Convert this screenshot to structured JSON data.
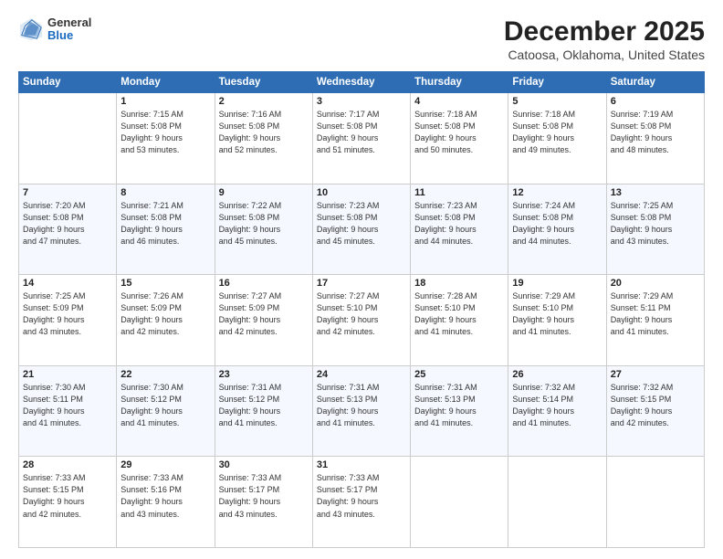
{
  "header": {
    "logo": {
      "general": "General",
      "blue": "Blue"
    },
    "title": "December 2025",
    "subtitle": "Catoosa, Oklahoma, United States"
  },
  "calendar": {
    "days_of_week": [
      "Sunday",
      "Monday",
      "Tuesday",
      "Wednesday",
      "Thursday",
      "Friday",
      "Saturday"
    ],
    "weeks": [
      [
        {
          "date": "",
          "info": ""
        },
        {
          "date": "1",
          "info": "Sunrise: 7:15 AM\nSunset: 5:08 PM\nDaylight: 9 hours\nand 53 minutes."
        },
        {
          "date": "2",
          "info": "Sunrise: 7:16 AM\nSunset: 5:08 PM\nDaylight: 9 hours\nand 52 minutes."
        },
        {
          "date": "3",
          "info": "Sunrise: 7:17 AM\nSunset: 5:08 PM\nDaylight: 9 hours\nand 51 minutes."
        },
        {
          "date": "4",
          "info": "Sunrise: 7:18 AM\nSunset: 5:08 PM\nDaylight: 9 hours\nand 50 minutes."
        },
        {
          "date": "5",
          "info": "Sunrise: 7:18 AM\nSunset: 5:08 PM\nDaylight: 9 hours\nand 49 minutes."
        },
        {
          "date": "6",
          "info": "Sunrise: 7:19 AM\nSunset: 5:08 PM\nDaylight: 9 hours\nand 48 minutes."
        }
      ],
      [
        {
          "date": "7",
          "info": "Sunrise: 7:20 AM\nSunset: 5:08 PM\nDaylight: 9 hours\nand 47 minutes."
        },
        {
          "date": "8",
          "info": "Sunrise: 7:21 AM\nSunset: 5:08 PM\nDaylight: 9 hours\nand 46 minutes."
        },
        {
          "date": "9",
          "info": "Sunrise: 7:22 AM\nSunset: 5:08 PM\nDaylight: 9 hours\nand 45 minutes."
        },
        {
          "date": "10",
          "info": "Sunrise: 7:23 AM\nSunset: 5:08 PM\nDaylight: 9 hours\nand 45 minutes."
        },
        {
          "date": "11",
          "info": "Sunrise: 7:23 AM\nSunset: 5:08 PM\nDaylight: 9 hours\nand 44 minutes."
        },
        {
          "date": "12",
          "info": "Sunrise: 7:24 AM\nSunset: 5:08 PM\nDaylight: 9 hours\nand 44 minutes."
        },
        {
          "date": "13",
          "info": "Sunrise: 7:25 AM\nSunset: 5:08 PM\nDaylight: 9 hours\nand 43 minutes."
        }
      ],
      [
        {
          "date": "14",
          "info": "Sunrise: 7:25 AM\nSunset: 5:09 PM\nDaylight: 9 hours\nand 43 minutes."
        },
        {
          "date": "15",
          "info": "Sunrise: 7:26 AM\nSunset: 5:09 PM\nDaylight: 9 hours\nand 42 minutes."
        },
        {
          "date": "16",
          "info": "Sunrise: 7:27 AM\nSunset: 5:09 PM\nDaylight: 9 hours\nand 42 minutes."
        },
        {
          "date": "17",
          "info": "Sunrise: 7:27 AM\nSunset: 5:10 PM\nDaylight: 9 hours\nand 42 minutes."
        },
        {
          "date": "18",
          "info": "Sunrise: 7:28 AM\nSunset: 5:10 PM\nDaylight: 9 hours\nand 41 minutes."
        },
        {
          "date": "19",
          "info": "Sunrise: 7:29 AM\nSunset: 5:10 PM\nDaylight: 9 hours\nand 41 minutes."
        },
        {
          "date": "20",
          "info": "Sunrise: 7:29 AM\nSunset: 5:11 PM\nDaylight: 9 hours\nand 41 minutes."
        }
      ],
      [
        {
          "date": "21",
          "info": "Sunrise: 7:30 AM\nSunset: 5:11 PM\nDaylight: 9 hours\nand 41 minutes."
        },
        {
          "date": "22",
          "info": "Sunrise: 7:30 AM\nSunset: 5:12 PM\nDaylight: 9 hours\nand 41 minutes."
        },
        {
          "date": "23",
          "info": "Sunrise: 7:31 AM\nSunset: 5:12 PM\nDaylight: 9 hours\nand 41 minutes."
        },
        {
          "date": "24",
          "info": "Sunrise: 7:31 AM\nSunset: 5:13 PM\nDaylight: 9 hours\nand 41 minutes."
        },
        {
          "date": "25",
          "info": "Sunrise: 7:31 AM\nSunset: 5:13 PM\nDaylight: 9 hours\nand 41 minutes."
        },
        {
          "date": "26",
          "info": "Sunrise: 7:32 AM\nSunset: 5:14 PM\nDaylight: 9 hours\nand 41 minutes."
        },
        {
          "date": "27",
          "info": "Sunrise: 7:32 AM\nSunset: 5:15 PM\nDaylight: 9 hours\nand 42 minutes."
        }
      ],
      [
        {
          "date": "28",
          "info": "Sunrise: 7:33 AM\nSunset: 5:15 PM\nDaylight: 9 hours\nand 42 minutes."
        },
        {
          "date": "29",
          "info": "Sunrise: 7:33 AM\nSunset: 5:16 PM\nDaylight: 9 hours\nand 43 minutes."
        },
        {
          "date": "30",
          "info": "Sunrise: 7:33 AM\nSunset: 5:17 PM\nDaylight: 9 hours\nand 43 minutes."
        },
        {
          "date": "31",
          "info": "Sunrise: 7:33 AM\nSunset: 5:17 PM\nDaylight: 9 hours\nand 43 minutes."
        },
        {
          "date": "",
          "info": ""
        },
        {
          "date": "",
          "info": ""
        },
        {
          "date": "",
          "info": ""
        }
      ]
    ]
  }
}
